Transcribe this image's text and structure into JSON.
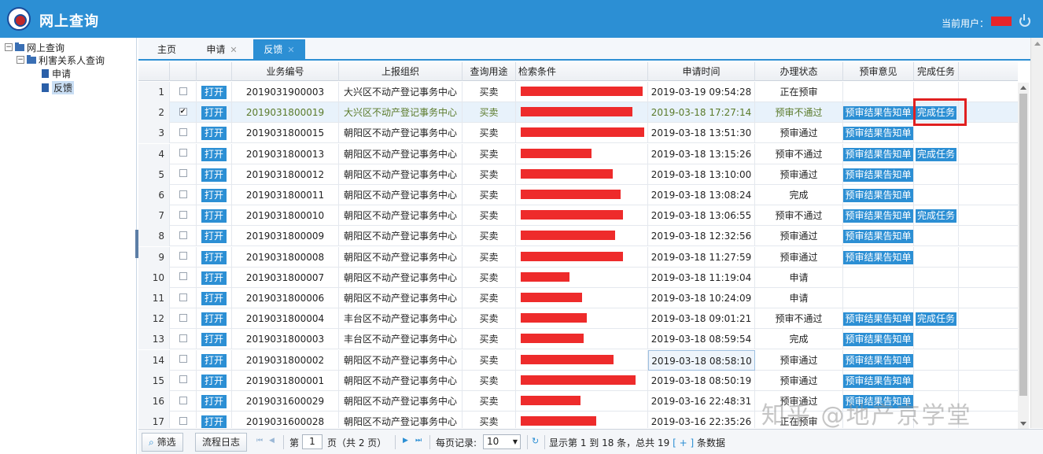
{
  "header": {
    "title": "网上查询",
    "user_label": "当前用户："
  },
  "sidebar": {
    "root": "网上查询",
    "group": "利害关系人查询",
    "items": [
      "申请",
      "反馈"
    ]
  },
  "tabs": [
    {
      "label": "主页",
      "closable": false,
      "active": false
    },
    {
      "label": "申请",
      "closable": true,
      "active": false
    },
    {
      "label": "反馈",
      "closable": true,
      "active": true
    }
  ],
  "table": {
    "columns": [
      "",
      "",
      "",
      "业务编号",
      "上报组织",
      "查询用途",
      "检索条件",
      "申请时间",
      "办理状态",
      "预审意见",
      "完成任务"
    ],
    "open_label": "打开",
    "opinion_label": "预审结果告知单",
    "complete_label": "完成任务",
    "rows": [
      {
        "num": "1",
        "checked": false,
        "id": "2019031900003",
        "org": "大兴区不动产登记事务中心",
        "purpose": "买卖",
        "time": "2019-03-19 09:54:28",
        "status": "正在预审",
        "opinion": false,
        "complete": false
      },
      {
        "num": "2",
        "checked": true,
        "id": "2019031800019",
        "org": "大兴区不动产登记事务中心",
        "purpose": "买卖",
        "time": "2019-03-18 17:27:14",
        "status": "预审不通过",
        "opinion": true,
        "complete": true
      },
      {
        "num": "3",
        "checked": false,
        "id": "2019031800015",
        "org": "朝阳区不动产登记事务中心",
        "purpose": "买卖",
        "time": "2019-03-18 13:51:30",
        "status": "预审通过",
        "opinion": true,
        "complete": false
      },
      {
        "num": "4",
        "checked": false,
        "id": "2019031800013",
        "org": "朝阳区不动产登记事务中心",
        "purpose": "买卖",
        "time": "2019-03-18 13:15:26",
        "status": "预审不通过",
        "opinion": true,
        "complete": true
      },
      {
        "num": "5",
        "checked": false,
        "id": "2019031800012",
        "org": "朝阳区不动产登记事务中心",
        "purpose": "买卖",
        "time": "2019-03-18 13:10:00",
        "status": "预审通过",
        "opinion": true,
        "complete": false
      },
      {
        "num": "6",
        "checked": false,
        "id": "2019031800011",
        "org": "朝阳区不动产登记事务中心",
        "purpose": "买卖",
        "time": "2019-03-18 13:08:24",
        "status": "完成",
        "opinion": true,
        "complete": false
      },
      {
        "num": "7",
        "checked": false,
        "id": "2019031800010",
        "org": "朝阳区不动产登记事务中心",
        "purpose": "买卖",
        "time": "2019-03-18 13:06:55",
        "status": "预审不通过",
        "opinion": true,
        "complete": true
      },
      {
        "num": "8",
        "checked": false,
        "id": "2019031800009",
        "org": "朝阳区不动产登记事务中心",
        "purpose": "买卖",
        "time": "2019-03-18 12:32:56",
        "status": "预审通过",
        "opinion": true,
        "complete": false
      },
      {
        "num": "9",
        "checked": false,
        "id": "2019031800008",
        "org": "朝阳区不动产登记事务中心",
        "purpose": "买卖",
        "time": "2019-03-18 11:27:59",
        "status": "预审通过",
        "opinion": true,
        "complete": false
      },
      {
        "num": "10",
        "checked": false,
        "id": "2019031800007",
        "org": "朝阳区不动产登记事务中心",
        "purpose": "买卖",
        "time": "2019-03-18 11:19:04",
        "status": "申请",
        "opinion": false,
        "complete": false
      },
      {
        "num": "11",
        "checked": false,
        "id": "2019031800006",
        "org": "朝阳区不动产登记事务中心",
        "purpose": "买卖",
        "time": "2019-03-18 10:24:09",
        "status": "申请",
        "opinion": false,
        "complete": false
      },
      {
        "num": "12",
        "checked": false,
        "id": "2019031800004",
        "org": "丰台区不动产登记事务中心",
        "purpose": "买卖",
        "time": "2019-03-18 09:01:21",
        "status": "预审不通过",
        "opinion": true,
        "complete": true
      },
      {
        "num": "13",
        "checked": false,
        "id": "2019031800003",
        "org": "丰台区不动产登记事务中心",
        "purpose": "买卖",
        "time": "2019-03-18 08:59:54",
        "status": "完成",
        "opinion": true,
        "complete": false
      },
      {
        "num": "14",
        "checked": false,
        "id": "2019031800002",
        "org": "朝阳区不动产登记事务中心",
        "purpose": "买卖",
        "time": "2019-03-18 08:58:10",
        "status": "预审通过",
        "opinion": true,
        "complete": false
      },
      {
        "num": "15",
        "checked": false,
        "id": "2019031800001",
        "org": "朝阳区不动产登记事务中心",
        "purpose": "买卖",
        "time": "2019-03-18 08:50:19",
        "status": "预审通过",
        "opinion": true,
        "complete": false
      },
      {
        "num": "16",
        "checked": false,
        "id": "2019031600029",
        "org": "朝阳区不动产登记事务中心",
        "purpose": "买卖",
        "time": "2019-03-16 22:48:31",
        "status": "预审通过",
        "opinion": true,
        "complete": false
      },
      {
        "num": "17",
        "checked": false,
        "id": "2019031600028",
        "org": "朝阳区不动产登记事务中心",
        "purpose": "买卖",
        "time": "2019-03-16 22:35:26",
        "status": "正在预审",
        "opinion": false,
        "complete": false
      }
    ]
  },
  "pager": {
    "filter_label": "筛选",
    "log_label": "流程日志",
    "page_prefix": "第",
    "page_value": "1",
    "page_suffix": "页（共 2 页）",
    "per_page_label": "每页记录:",
    "per_page_value": "10",
    "summary_prefix": "显示第 1 到 18 条，总共 19",
    "summary_link": "[ + ]",
    "summary_suffix": "条数据"
  },
  "watermark": "知乎 @地产京学堂",
  "colors": {
    "header": "#2c8fd4",
    "accent": "#2c8fd4",
    "highlight": "#e02020",
    "redaction": "#ee2b2b"
  }
}
